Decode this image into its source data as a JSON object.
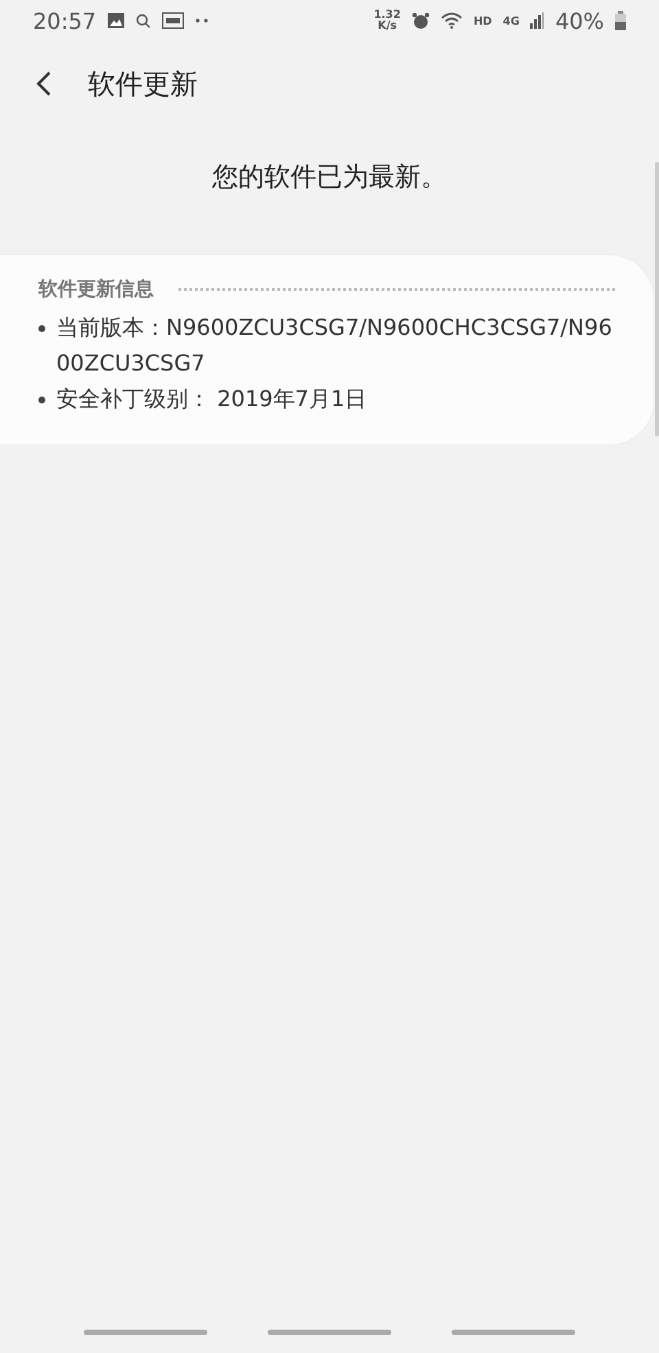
{
  "status_bar": {
    "time": "20:57",
    "speed_value": "1.32",
    "speed_unit": "K/s",
    "hd": "HD",
    "network": "4G",
    "battery": "40%"
  },
  "header": {
    "title": "软件更新"
  },
  "message": "您的软件已为最新。",
  "info_card": {
    "title": "软件更新信息",
    "items": [
      {
        "text": "当前版本：N9600ZCU3CSG7/N9600CHC3CSG7/N9600ZCU3CSG7"
      },
      {
        "text": "安全补丁级别： 2019年7月1日"
      }
    ]
  }
}
